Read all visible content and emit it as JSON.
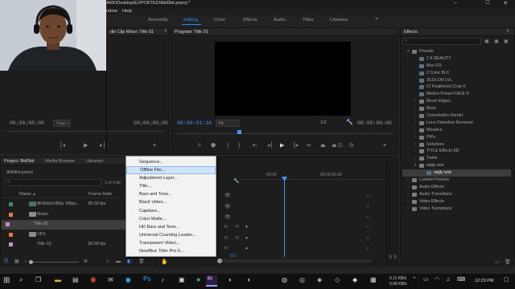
{
  "window": {
    "title_path": "ARK\\Desktop\\EXPORTED\\8kil0bit.prproj *",
    "menu": [
      "ndow",
      "Help"
    ]
  },
  "workspaces": [
    "Assembly",
    "Editing",
    "Color",
    "Effects",
    "Audio",
    "Titles",
    "Libraries"
  ],
  "active_workspace": "Editing",
  "source_panel": {
    "title": "dio Clip Mixer: Title 01",
    "timecode_left": "00;00;00;00",
    "page_label": "Page 1",
    "timecode_right": "00;00;00;00"
  },
  "program_panel": {
    "title": "Program: Title 01",
    "timecode": "00:00:01:18",
    "fit": "Fit",
    "resolution": "1/2",
    "timecode_end": "00:00:00:00"
  },
  "effects_panel": {
    "title": "Effects",
    "items": [
      {
        "label": "Presets",
        "level": 0,
        "type": "folder",
        "expanded": true
      },
      {
        "label": "1 K BEAUTY",
        "level": 1,
        "type": "preset"
      },
      {
        "label": "Blur GS",
        "level": 1,
        "type": "preset"
      },
      {
        "label": "2 Color BLC",
        "level": 1,
        "type": "preset"
      },
      {
        "label": "3COLOR LVL",
        "level": 1,
        "type": "preset"
      },
      {
        "label": "CI Feathered Crop K",
        "level": 1,
        "type": "preset"
      },
      {
        "label": "Motion Preset FACE K",
        "level": 1,
        "type": "preset"
      },
      {
        "label": "Bevel Edges",
        "level": 1,
        "type": "folder"
      },
      {
        "label": "Blurs",
        "level": 1,
        "type": "folder"
      },
      {
        "label": "Convolution Kernel",
        "level": 1,
        "type": "folder"
      },
      {
        "label": "Lens Distortion Removal",
        "level": 1,
        "type": "folder"
      },
      {
        "label": "Mosaics",
        "level": 1,
        "type": "folder"
      },
      {
        "label": "PiPs",
        "level": 1,
        "type": "folder"
      },
      {
        "label": "Solarizes",
        "level": 1,
        "type": "folder"
      },
      {
        "label": "TITLE Effects KB",
        "level": 1,
        "type": "folder"
      },
      {
        "label": "Twirls",
        "level": 1,
        "type": "folder"
      },
      {
        "label": "wigly test",
        "level": 1,
        "type": "folder",
        "expanded": true
      },
      {
        "label": "wigly test",
        "level": 2,
        "type": "preset",
        "selected": true
      },
      {
        "label": "Lumetri Presets",
        "level": 0,
        "type": "folder"
      },
      {
        "label": "Audio Effects",
        "level": 0,
        "type": "folder"
      },
      {
        "label": "Audio Transitions",
        "level": 0,
        "type": "folder"
      },
      {
        "label": "Video Effects",
        "level": 0,
        "type": "folder"
      },
      {
        "label": "Video Transitions",
        "level": 0,
        "type": "folder"
      }
    ]
  },
  "project_panel": {
    "tabs": [
      "Project: 8kil0bit",
      "Media Browser",
      "Libraries"
    ],
    "active_tab": "Project: 8kil0bit",
    "file": "8kil0bit.prproj",
    "items_count": "1 of 6 ite",
    "col_name": "Name",
    "col_rate": "Frame Rate",
    "rows": [
      {
        "name": "8Kil0bit1080p 30fps...",
        "rate": "30.00 fps",
        "kind": "sequence",
        "color": "#3a8a6a"
      },
      {
        "name": "Music",
        "rate": "",
        "kind": "folder",
        "color": "#e07a38"
      },
      {
        "name": "Title 01",
        "rate": "",
        "kind": "title",
        "color": "#c78ecb",
        "selected": true
      },
      {
        "name": "VFX",
        "rate": "",
        "kind": "folder",
        "color": "#e07a38"
      },
      {
        "name": "Title 01",
        "rate": "30.00 fps",
        "kind": "title",
        "color": "#c78ecb"
      }
    ]
  },
  "context_menu": {
    "items": [
      "Sequence...",
      "Offline File...",
      "Adjustment Layer...",
      "Title...",
      "Bars and Tone...",
      "Black Video...",
      "Captions...",
      "Color Matte...",
      "HD Bars and Tone...",
      "Universal Counting Leader...",
      "Transparent Video...",
      "NewBlue Titler Pro 5..."
    ],
    "selected_index": 1
  },
  "timeline": {
    "ruler_start": ":00:00",
    "ruler_mid": "00:00:05:00",
    "track_labels": [
      "H",
      "H",
      "H",
      "H",
      "H"
    ],
    "sub_label": "0.0"
  },
  "taskbar": {
    "network_up": "0.11 KB/s",
    "network_down": "0.06 KB/s",
    "time": "12:23 PM"
  },
  "colors": {
    "accent_blue": "#2d8ceb",
    "playhead": "#4a90ff",
    "label_lavender": "#c78ecb",
    "label_orange": "#e07a38"
  }
}
